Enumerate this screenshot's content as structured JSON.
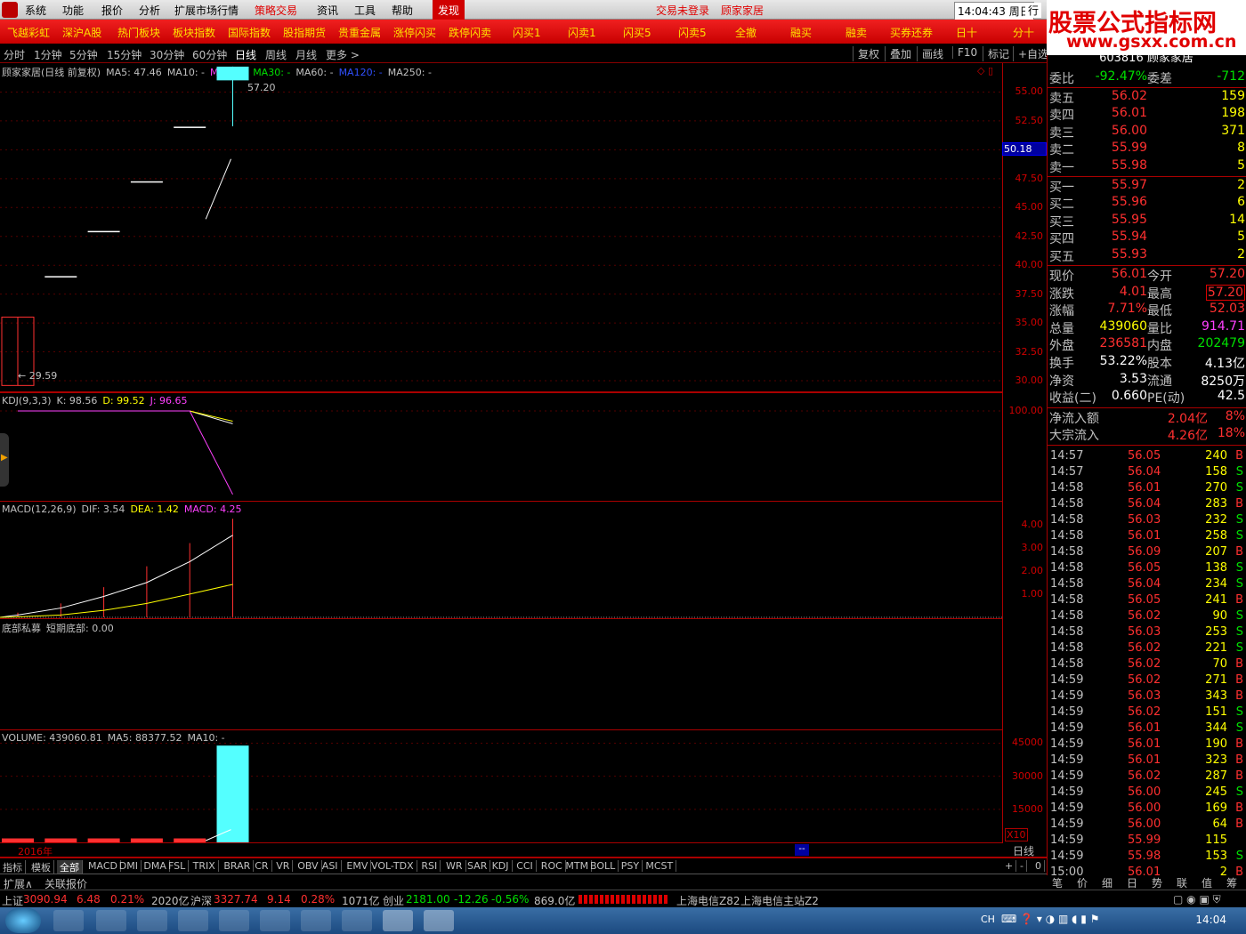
{
  "menubar": {
    "items": [
      "系统",
      "功能",
      "报价",
      "分析",
      "扩展市场行情",
      "策略交易",
      "资讯",
      "工具",
      "帮助",
      "发现"
    ],
    "login": "交易未登录",
    "stock": "顾家家居",
    "time": "14:04:43",
    "weekday": "周日",
    "right": "行"
  },
  "toolbar": {
    "items": [
      "飞越彩虹",
      "深沪A股",
      "热门板块",
      "板块指数",
      "国际指数",
      "股指期货",
      "贵重金属",
      "涨停闪买",
      "跌停闪卖",
      "闪买1",
      "闪卖1",
      "闪买5",
      "闪卖5",
      "全撤",
      "融买",
      "融卖",
      "买券还券",
      "日十",
      "分十"
    ]
  },
  "watermark": {
    "line1": "股票公式指标网",
    "line2": "www.gsxx.com.cn"
  },
  "periods": {
    "items": [
      "分时",
      "1分钟",
      "5分钟",
      "15分钟",
      "30分钟",
      "60分钟",
      "日线",
      "周线",
      "月线",
      "更多 >"
    ],
    "active": "日线",
    "buttons": [
      "复权",
      "叠加",
      "画线",
      "F10",
      "标记",
      "+自选"
    ]
  },
  "main": {
    "title": "顾家家居(日线 前复权)",
    "ma5": "MA5: 47.46",
    "ma10": "MA10: -",
    "ma20": "MA20: -",
    "ma30": "MA30: -",
    "ma60": "MA60: -",
    "ma120": "MA120: -",
    "ma250": "MA250: -",
    "high_label": "57.20",
    "low_label": "29.59",
    "cursor_price": "50.18",
    "ticks": [
      "55.00",
      "52.50",
      "50.00",
      "47.50",
      "45.00",
      "42.50",
      "40.00",
      "37.50",
      "35.00",
      "32.50",
      "30.00"
    ]
  },
  "kdj": {
    "title": "KDJ(9,3,3)",
    "k": "K: 98.56",
    "d": "D: 99.52",
    "j": "J: 96.65",
    "tick": "100.00"
  },
  "macd": {
    "title": "MACD(12,26,9)",
    "dif": "DIF: 3.54",
    "dea": "DEA: 1.42",
    "macd": "MACD: 4.25",
    "ticks": [
      "4.00",
      "3.00",
      "2.00",
      "1.00"
    ]
  },
  "dibu": {
    "title": "底部私募",
    "value": "短期底部: 0.00"
  },
  "volume": {
    "title": "VOLUME: 439060.81",
    "ma5": "MA5: 88377.52",
    "ma10": "MA10: -",
    "ticks": [
      "45000",
      "30000",
      "15000"
    ],
    "unit": "X10"
  },
  "xaxis": {
    "year": "2016年",
    "period": "日线",
    "marker": "--"
  },
  "chart_data": {
    "type": "candlestick",
    "candles": [
      {
        "o": 29.59,
        "h": 35.51,
        "l": 29.59,
        "c": 35.51
      },
      {
        "o": 39.06,
        "h": 39.06,
        "l": 39.06,
        "c": 39.06
      },
      {
        "o": 42.97,
        "h": 42.97,
        "l": 42.97,
        "c": 42.97
      },
      {
        "o": 47.27,
        "h": 47.27,
        "l": 47.27,
        "c": 47.27
      },
      {
        "o": 52.0,
        "h": 52.0,
        "l": 52.0,
        "c": 52.0
      },
      {
        "o": 57.2,
        "h": 57.2,
        "l": 52.03,
        "c": 56.01
      }
    ],
    "volume": [
      1800,
      1800,
      1800,
      1800,
      1800,
      43906
    ],
    "ylim": [
      29.0,
      57.5
    ],
    "vol_ylim": [
      0,
      46000
    ],
    "macd_hist": [
      0.2,
      0.6,
      1.3,
      2.2,
      3.2,
      4.25
    ],
    "macd_dif": [
      0.1,
      0.4,
      0.9,
      1.5,
      2.4,
      3.54
    ],
    "macd_dea": [
      0.02,
      0.1,
      0.3,
      0.6,
      1.0,
      1.42
    ],
    "macd_ylim": [
      0,
      4.6
    ],
    "kdj_k": [
      100,
      100,
      100,
      100,
      100,
      98.56
    ],
    "kdj_d": [
      100,
      100,
      100,
      100,
      100,
      99.52
    ],
    "kdj_j": [
      100,
      100,
      100,
      100,
      100,
      96.65
    ]
  },
  "info": {
    "code": "603816",
    "name": "顾家家居",
    "weibi": {
      "label": "委比",
      "value": "-92.47%",
      "label2": "委差",
      "value2": "-712"
    },
    "sells": [
      {
        "l": "卖五",
        "p": "56.02",
        "v": "159"
      },
      {
        "l": "卖四",
        "p": "56.01",
        "v": "198"
      },
      {
        "l": "卖三",
        "p": "56.00",
        "v": "371"
      },
      {
        "l": "卖二",
        "p": "55.99",
        "v": "8"
      },
      {
        "l": "卖一",
        "p": "55.98",
        "v": "5"
      }
    ],
    "buys": [
      {
        "l": "买一",
        "p": "55.97",
        "v": "2"
      },
      {
        "l": "买二",
        "p": "55.96",
        "v": "6"
      },
      {
        "l": "买三",
        "p": "55.95",
        "v": "14"
      },
      {
        "l": "买四",
        "p": "55.94",
        "v": "5"
      },
      {
        "l": "买五",
        "p": "55.93",
        "v": "2"
      }
    ],
    "stats": [
      {
        "k": "现价",
        "v": "56.01",
        "k2": "今开",
        "v2": "57.20",
        "c1": "red",
        "c2": "red"
      },
      {
        "k": "涨跌",
        "v": "4.01",
        "k2": "最高",
        "v2": "57.20",
        "c1": "red",
        "c2": "red"
      },
      {
        "k": "涨幅",
        "v": "7.71%",
        "k2": "最低",
        "v2": "52.03",
        "c1": "red",
        "c2": "red"
      },
      {
        "k": "总量",
        "v": "439060",
        "k2": "量比",
        "v2": "914.71",
        "c1": "yellow",
        "c2": "mag"
      },
      {
        "k": "外盘",
        "v": "236581",
        "k2": "内盘",
        "v2": "202479",
        "c1": "red",
        "c2": "green"
      },
      {
        "k": "换手",
        "v": "53.22%",
        "k2": "股本",
        "v2": "4.13亿",
        "c1": "white",
        "c2": "white"
      },
      {
        "k": "净资",
        "v": "3.53",
        "k2": "流通",
        "v2": "8250万",
        "c1": "white",
        "c2": "white"
      },
      {
        "k": "收益(二)",
        "v": "0.660",
        "k2": "PE(动)",
        "v2": "42.5",
        "c1": "white",
        "c2": "white"
      }
    ],
    "flows": [
      {
        "k": "净流入额",
        "v": "2.04亿",
        "p": "8%"
      },
      {
        "k": "大宗流入",
        "v": "4.26亿",
        "p": "18%"
      }
    ],
    "trades": [
      [
        "14:57",
        "56.05",
        "240",
        "B"
      ],
      [
        "14:57",
        "56.04",
        "158",
        "S"
      ],
      [
        "14:58",
        "56.01",
        "270",
        "S"
      ],
      [
        "14:58",
        "56.04",
        "283",
        "B"
      ],
      [
        "14:58",
        "56.03",
        "232",
        "S"
      ],
      [
        "14:58",
        "56.01",
        "258",
        "S"
      ],
      [
        "14:58",
        "56.09",
        "207",
        "B"
      ],
      [
        "14:58",
        "56.05",
        "138",
        "S"
      ],
      [
        "14:58",
        "56.04",
        "234",
        "S"
      ],
      [
        "14:58",
        "56.05",
        "241",
        "B"
      ],
      [
        "14:58",
        "56.02",
        "90",
        "S"
      ],
      [
        "14:58",
        "56.03",
        "253",
        "S"
      ],
      [
        "14:58",
        "56.02",
        "221",
        "S"
      ],
      [
        "14:58",
        "56.02",
        "70",
        "B"
      ],
      [
        "14:59",
        "56.02",
        "271",
        "B"
      ],
      [
        "14:59",
        "56.03",
        "343",
        "B"
      ],
      [
        "14:59",
        "56.02",
        "151",
        "S"
      ],
      [
        "14:59",
        "56.01",
        "344",
        "S"
      ],
      [
        "14:59",
        "56.01",
        "190",
        "B"
      ],
      [
        "14:59",
        "56.01",
        "323",
        "B"
      ],
      [
        "14:59",
        "56.02",
        "287",
        "B"
      ],
      [
        "14:59",
        "56.00",
        "245",
        "S"
      ],
      [
        "14:59",
        "56.00",
        "169",
        "B"
      ],
      [
        "14:59",
        "56.00",
        "64",
        "B"
      ],
      [
        "14:59",
        "55.99",
        "115",
        ""
      ],
      [
        "14:59",
        "55.98",
        "153",
        "S"
      ],
      [
        "15:00",
        "56.01",
        "2",
        "B"
      ]
    ]
  },
  "indicators": [
    "指标",
    "模板",
    "全部",
    "MACD",
    "DMI",
    "DMA",
    "FSL",
    "TRIX",
    "BRAR",
    "CR",
    "VR",
    "OBV",
    "ASI",
    "EMV",
    "VOL-TDX",
    "RSI",
    "WR",
    "SAR",
    "KDJ",
    "CCI",
    "ROC",
    "MTM",
    "BOLL",
    "PSY",
    "MCST"
  ],
  "indicator_ctrl": [
    "+",
    "-",
    "0"
  ],
  "ext": {
    "a": "扩展∧",
    "b": "关联报价"
  },
  "righttabs": [
    "笔",
    "价",
    "细",
    "日",
    "势",
    "联",
    "值",
    "筹"
  ],
  "status": {
    "sh_label": "上证",
    "sh_val": "3090.94",
    "sh_chg": "6.48",
    "sh_pct": "0.21%",
    "sh_amt": "2020亿",
    "sz_label": "沪深",
    "sz_val": "3327.74",
    "sz_chg": "9.14",
    "sz_pct": "0.28%",
    "sz_amt": "1071亿",
    "cy_label": "创业",
    "cy_val": "2181.00",
    "cy_chg": "-12.26",
    "cy_pct": "-0.56%",
    "cy_amt": "869.0亿",
    "server1": "上海电信Z82",
    "server2": "上海电信主站Z2"
  },
  "taskbar": {
    "lang": "CH",
    "time": "14:04"
  }
}
